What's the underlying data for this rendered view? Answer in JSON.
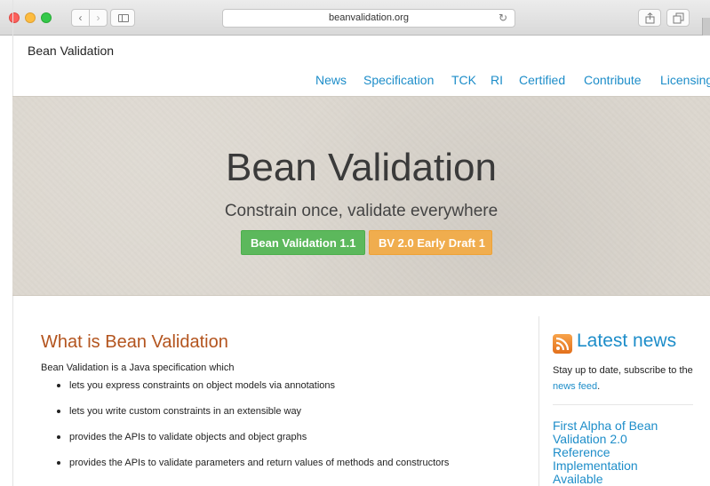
{
  "browser": {
    "url": "beanvalidation.org"
  },
  "site": {
    "brand": "Bean Validation",
    "nav": [
      "News",
      "Specification",
      "TCK",
      "RI",
      "Certified",
      "Contribute",
      "Licensing"
    ]
  },
  "hero": {
    "title": "Bean Validation",
    "subtitle": "Constrain once, validate everywhere",
    "button_primary": "Bean Validation 1.1",
    "button_secondary": "BV 2.0 Early Draft 1"
  },
  "main": {
    "heading": "What is Bean Validation",
    "intro": "Bean Validation is a Java specification which",
    "features": [
      "lets you express constraints on object models via annotations",
      "lets you write custom constraints in an extensible way",
      "provides the APIs to validate objects and object graphs",
      "provides the APIs to validate parameters and return values of methods and constructors"
    ]
  },
  "sidebar": {
    "heading": "Latest news",
    "desc_prefix": "Stay up to date, subscribe to the ",
    "feed_link": "news feed",
    "desc_suffix": ".",
    "news_item": "First Alpha of Bean Validation 2.0 Reference Implementation Available"
  },
  "colors": {
    "link": "#1d8dc9",
    "heading_orange": "#b3541e",
    "button_green": "#5cb85c",
    "button_orange": "#f0ad4e"
  }
}
